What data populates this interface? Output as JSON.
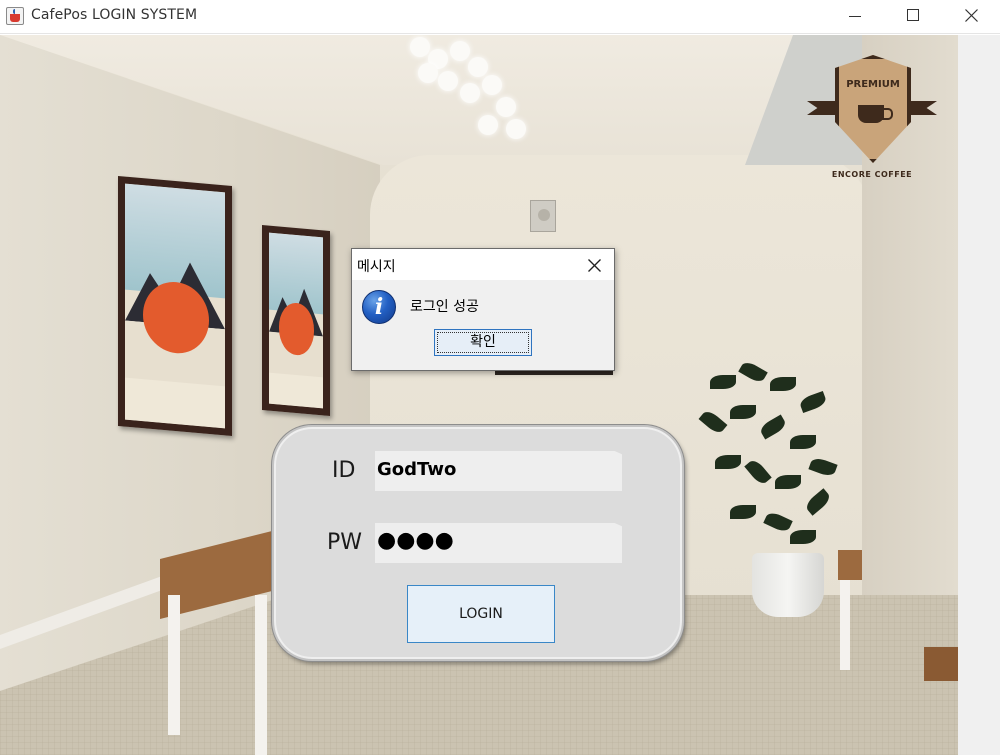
{
  "window": {
    "title": "CafePos LOGIN SYSTEM",
    "app_icon": "java-coffee-cup-icon",
    "controls": [
      "minimize-icon",
      "maximize-icon",
      "close-icon"
    ]
  },
  "background": {
    "logo": {
      "top_text": "PREMIUM",
      "brand_text": "ENCORE COFFEE",
      "colors": {
        "shield": "#c9a47a",
        "ink": "#3e2a1c"
      }
    }
  },
  "login": {
    "id_label": "ID",
    "id_value": "GodTwo",
    "pw_label": "PW",
    "pw_value": "●●●●",
    "login_button": "LOGIN"
  },
  "dialog": {
    "title": "메시지",
    "icon": "information-icon",
    "message": "로그인 성공",
    "ok_button": "확인",
    "colors": {
      "button_border": "#2f74c0",
      "info_icon": "#2360c4"
    }
  }
}
